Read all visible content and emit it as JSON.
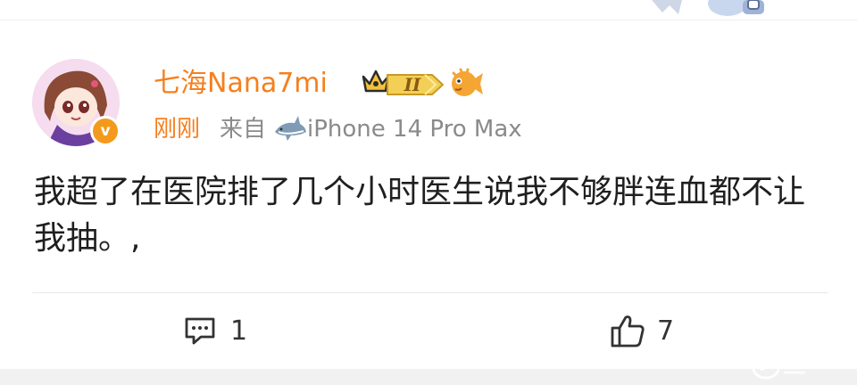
{
  "post": {
    "username": "七海Nana7mi",
    "level_badge": "II",
    "time": "刚刚",
    "from_label": "来自",
    "device": "iPhone 14 Pro Max",
    "verified_mark": "v",
    "content": "我超了在医院排了几个小时医生说我不够胖连血都不让我抽。,"
  },
  "actions": {
    "comment_count": "1",
    "like_count": "7"
  },
  "colors": {
    "username": "#f57f1d",
    "meta": "#8a8a8a",
    "text": "#1f1f1f",
    "verified": "#f39a1c"
  },
  "icons": {
    "crown": "crown-icon",
    "fish": "pufferfish-icon",
    "shark": "shark-icon",
    "comment": "comment-icon",
    "like": "thumbs-up-icon"
  }
}
